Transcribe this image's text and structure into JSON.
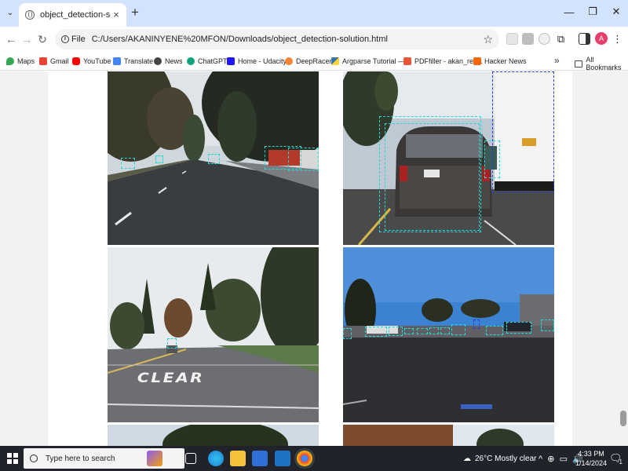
{
  "browser": {
    "tab_title": "object_detection-solution",
    "url_scheme_label": "File",
    "url": "C:/Users/AKANINYENE%20MFON/Downloads/object_detection-solution.html",
    "profile_initial": "A",
    "window_controls": [
      "minimize-icon",
      "restore-icon",
      "close-icon"
    ]
  },
  "bookmarks": [
    {
      "label": "Maps",
      "icon": "maps-icon",
      "color": "#34a853"
    },
    {
      "label": "Gmail",
      "icon": "gmail-icon",
      "color": "#ea4335"
    },
    {
      "label": "YouTube",
      "icon": "youtube-icon",
      "color": "#ff0000"
    },
    {
      "label": "Translate",
      "icon": "translate-icon",
      "color": "#4285f4"
    },
    {
      "label": "News",
      "icon": "news-icon",
      "color": "#444444"
    },
    {
      "label": "ChatGPT",
      "icon": "chatgpt-icon",
      "color": "#10a37f"
    },
    {
      "label": "Home - Udacity",
      "icon": "udacity-icon",
      "color": "#2015ff"
    },
    {
      "label": "DeepRacer",
      "icon": "deepracer-icon",
      "color": "#f58536"
    },
    {
      "label": "Argparse Tutorial —...",
      "icon": "python-icon",
      "color": "#3776ab"
    },
    {
      "label": "PDFfiller - akan_res...",
      "icon": "pdffiller-icon",
      "color": "#e8563a"
    },
    {
      "label": "Hacker News",
      "icon": "hackernews-icon",
      "color": "#ff6600"
    }
  ],
  "all_bookmarks_label": "All Bookmarks",
  "images": [
    {
      "name": "detection-result-1",
      "scene": "suburban road, trees, parked cars"
    },
    {
      "name": "detection-result-2",
      "scene": "following a dark SUV, truck on right"
    },
    {
      "name": "detection-result-3",
      "scene": "road with CLEAR marking"
    },
    {
      "name": "detection-result-4",
      "scene": "wide street with many cars"
    }
  ],
  "road_marking_text": "CLEAR",
  "taskbar": {
    "search_placeholder": "Type here to search",
    "weather": "26°C  Mostly clear",
    "time": "4:33 PM",
    "date": "1/14/2024",
    "notification_count": "1"
  }
}
